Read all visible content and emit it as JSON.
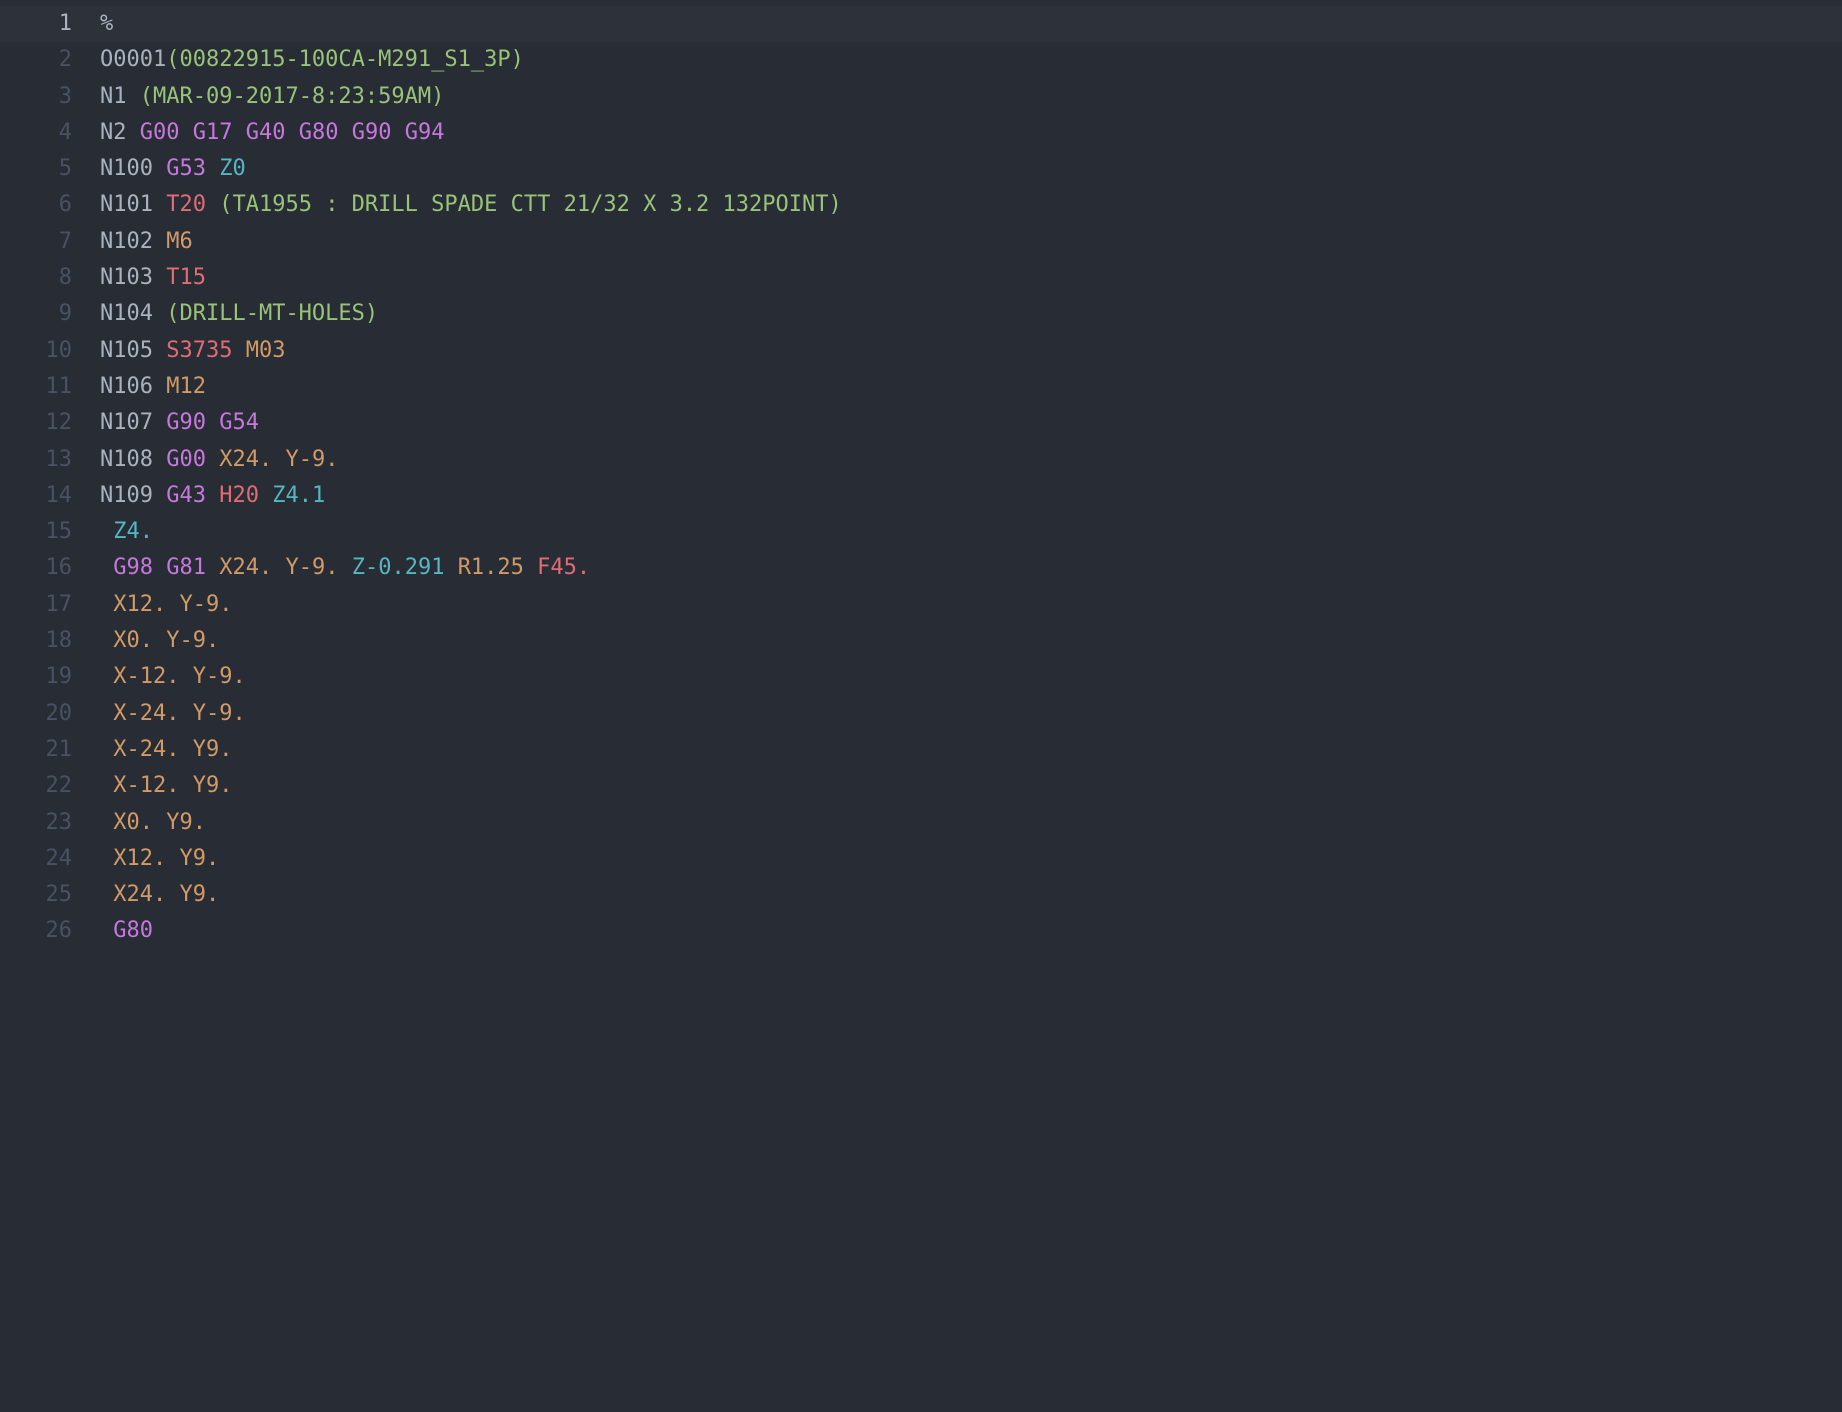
{
  "colors": {
    "bg": "#282c34",
    "activeLineBg": "#2c313a",
    "gutter": "#495162",
    "gutterActive": "#abb2bf",
    "plain": "#abb2bf",
    "comment": "#98c379",
    "orange": "#d19a66",
    "red": "#e06c75",
    "purple": "#c678dd",
    "cyan": "#56b6c2"
  },
  "active_line": 1,
  "lines": [
    {
      "n": 1,
      "tokens": [
        [
          "plain",
          "%"
        ]
      ]
    },
    {
      "n": 2,
      "tokens": [
        [
          "plain",
          "O0001"
        ],
        [
          "comment",
          "(00822915-100CA-M291_S1_3P)"
        ]
      ]
    },
    {
      "n": 3,
      "tokens": [
        [
          "plain",
          "N1 "
        ],
        [
          "comment",
          "(MAR-09-2017-8:23:59AM)"
        ]
      ]
    },
    {
      "n": 4,
      "tokens": [
        [
          "plain",
          "N2 "
        ],
        [
          "purple",
          "G00"
        ],
        [
          "plain",
          " "
        ],
        [
          "purple",
          "G17"
        ],
        [
          "plain",
          " "
        ],
        [
          "purple",
          "G40"
        ],
        [
          "plain",
          " "
        ],
        [
          "purple",
          "G80"
        ],
        [
          "plain",
          " "
        ],
        [
          "purple",
          "G90"
        ],
        [
          "plain",
          " "
        ],
        [
          "purple",
          "G94"
        ]
      ]
    },
    {
      "n": 5,
      "tokens": [
        [
          "plain",
          "N100 "
        ],
        [
          "purple",
          "G53"
        ],
        [
          "plain",
          " "
        ],
        [
          "cyan",
          "Z0"
        ]
      ]
    },
    {
      "n": 6,
      "tokens": [
        [
          "plain",
          "N101 "
        ],
        [
          "red",
          "T20"
        ],
        [
          "plain",
          " "
        ],
        [
          "comment",
          "(TA1955 : DRILL SPADE CTT 21/32 X 3.2 132POINT)"
        ]
      ]
    },
    {
      "n": 7,
      "tokens": [
        [
          "plain",
          "N102 "
        ],
        [
          "orange",
          "M6"
        ]
      ]
    },
    {
      "n": 8,
      "tokens": [
        [
          "plain",
          "N103 "
        ],
        [
          "red",
          "T15"
        ]
      ]
    },
    {
      "n": 9,
      "tokens": [
        [
          "plain",
          "N104 "
        ],
        [
          "comment",
          "(DRILL-MT-HOLES)"
        ]
      ]
    },
    {
      "n": 10,
      "tokens": [
        [
          "plain",
          "N105 "
        ],
        [
          "red",
          "S3735"
        ],
        [
          "plain",
          " "
        ],
        [
          "orange",
          "M03"
        ]
      ]
    },
    {
      "n": 11,
      "tokens": [
        [
          "plain",
          "N106 "
        ],
        [
          "orange",
          "M12"
        ]
      ]
    },
    {
      "n": 12,
      "tokens": [
        [
          "plain",
          "N107 "
        ],
        [
          "purple",
          "G90"
        ],
        [
          "plain",
          " "
        ],
        [
          "purple",
          "G54"
        ]
      ]
    },
    {
      "n": 13,
      "tokens": [
        [
          "plain",
          "N108 "
        ],
        [
          "purple",
          "G00"
        ],
        [
          "plain",
          " "
        ],
        [
          "orange",
          "X24."
        ],
        [
          "plain",
          " "
        ],
        [
          "orange",
          "Y-9."
        ]
      ]
    },
    {
      "n": 14,
      "tokens": [
        [
          "plain",
          "N109 "
        ],
        [
          "purple",
          "G43"
        ],
        [
          "plain",
          " "
        ],
        [
          "red",
          "H20"
        ],
        [
          "plain",
          " "
        ],
        [
          "cyan",
          "Z4.1"
        ]
      ]
    },
    {
      "n": 15,
      "tokens": [
        [
          "plain",
          " "
        ],
        [
          "cyan",
          "Z4."
        ]
      ]
    },
    {
      "n": 16,
      "tokens": [
        [
          "plain",
          " "
        ],
        [
          "purple",
          "G98"
        ],
        [
          "plain",
          " "
        ],
        [
          "purple",
          "G81"
        ],
        [
          "plain",
          " "
        ],
        [
          "orange",
          "X24."
        ],
        [
          "plain",
          " "
        ],
        [
          "orange",
          "Y-9."
        ],
        [
          "plain",
          " "
        ],
        [
          "cyan",
          "Z-0.291"
        ],
        [
          "plain",
          " "
        ],
        [
          "orange",
          "R1.25"
        ],
        [
          "plain",
          " "
        ],
        [
          "red",
          "F45."
        ]
      ]
    },
    {
      "n": 17,
      "tokens": [
        [
          "plain",
          " "
        ],
        [
          "orange",
          "X12."
        ],
        [
          "plain",
          " "
        ],
        [
          "orange",
          "Y-9."
        ]
      ]
    },
    {
      "n": 18,
      "tokens": [
        [
          "plain",
          " "
        ],
        [
          "orange",
          "X0."
        ],
        [
          "plain",
          " "
        ],
        [
          "orange",
          "Y-9."
        ]
      ]
    },
    {
      "n": 19,
      "tokens": [
        [
          "plain",
          " "
        ],
        [
          "orange",
          "X-12."
        ],
        [
          "plain",
          " "
        ],
        [
          "orange",
          "Y-9."
        ]
      ]
    },
    {
      "n": 20,
      "tokens": [
        [
          "plain",
          " "
        ],
        [
          "orange",
          "X-24."
        ],
        [
          "plain",
          " "
        ],
        [
          "orange",
          "Y-9."
        ]
      ]
    },
    {
      "n": 21,
      "tokens": [
        [
          "plain",
          " "
        ],
        [
          "orange",
          "X-24."
        ],
        [
          "plain",
          " "
        ],
        [
          "orange",
          "Y9."
        ]
      ]
    },
    {
      "n": 22,
      "tokens": [
        [
          "plain",
          " "
        ],
        [
          "orange",
          "X-12."
        ],
        [
          "plain",
          " "
        ],
        [
          "orange",
          "Y9."
        ]
      ]
    },
    {
      "n": 23,
      "tokens": [
        [
          "plain",
          " "
        ],
        [
          "orange",
          "X0."
        ],
        [
          "plain",
          " "
        ],
        [
          "orange",
          "Y9."
        ]
      ]
    },
    {
      "n": 24,
      "tokens": [
        [
          "plain",
          " "
        ],
        [
          "orange",
          "X12."
        ],
        [
          "plain",
          " "
        ],
        [
          "orange",
          "Y9."
        ]
      ]
    },
    {
      "n": 25,
      "tokens": [
        [
          "plain",
          " "
        ],
        [
          "orange",
          "X24."
        ],
        [
          "plain",
          " "
        ],
        [
          "orange",
          "Y9."
        ]
      ]
    },
    {
      "n": 26,
      "tokens": [
        [
          "plain",
          " "
        ],
        [
          "purple",
          "G80"
        ]
      ]
    }
  ]
}
